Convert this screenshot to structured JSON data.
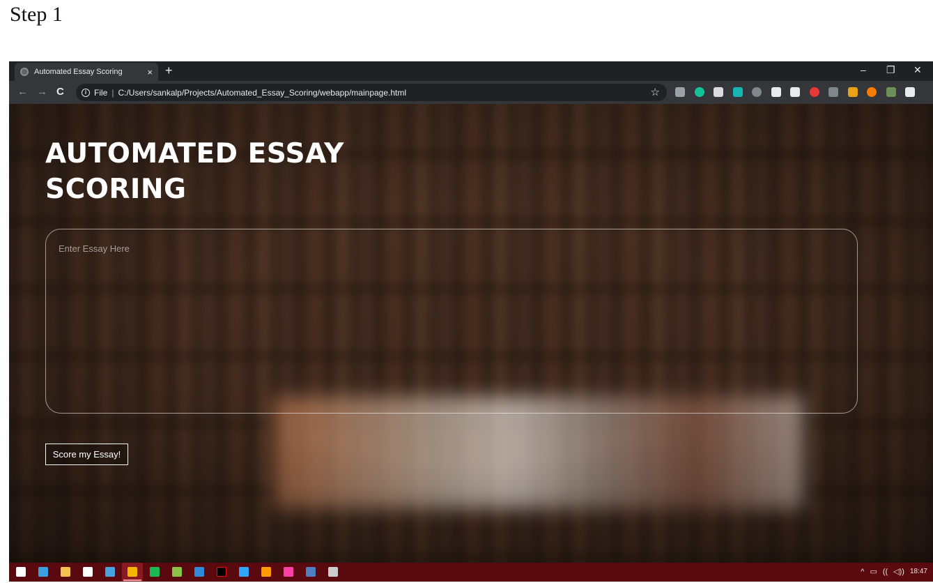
{
  "caption": "Step 1",
  "browser": {
    "tab_title": "Automated Essay Scoring",
    "tab_close": "×",
    "new_tab": "+",
    "window_controls": {
      "minimize": "–",
      "restore": "❐",
      "close": "✕"
    },
    "nav": {
      "back": "←",
      "forward": "→",
      "reload": "C"
    },
    "address": {
      "scheme_label": "File",
      "separator": "|",
      "url": "C:/Users/sankalp/Projects/Automated_Essay_Scoring/webapp/mainpage.html"
    },
    "bookmark_icon": "☆",
    "extensions": [
      {
        "name": "ext-e-icon",
        "color": "#9aa0a6"
      },
      {
        "name": "ext-grammarly-icon",
        "color": "#15c39a"
      },
      {
        "name": "ext-camera-icon",
        "color": "#dadce0"
      },
      {
        "name": "ext-teal-icon",
        "color": "#17b4b4"
      },
      {
        "name": "ext-copy-icon",
        "color": "#80868b"
      },
      {
        "name": "ext-check-icon",
        "color": "#e8eaed"
      },
      {
        "name": "ext-note-icon",
        "color": "#e8eaed"
      },
      {
        "name": "ext-red-icon",
        "color": "#e53935"
      },
      {
        "name": "ext-grey-icon",
        "color": "#80868b"
      },
      {
        "name": "ext-w-icon",
        "color": "#e8a317"
      },
      {
        "name": "ext-off-icon",
        "color": "#f57c00"
      },
      {
        "name": "profile-avatar-icon",
        "color": "#6b8e5a"
      },
      {
        "name": "menu-kebab-icon",
        "color": "#e8eaed"
      }
    ]
  },
  "page": {
    "title": "AUTOMATED ESSAY SCORING",
    "essay_placeholder": "Enter Essay Here",
    "score_button": "Score my Essay!"
  },
  "taskbar": {
    "icons": [
      {
        "name": "windows-start-icon",
        "color": "#ffffff"
      },
      {
        "name": "edge-icon",
        "color": "#3b9fe0"
      },
      {
        "name": "file-explorer-icon",
        "color": "#f2c14e"
      },
      {
        "name": "store-icon",
        "color": "#ffffff"
      },
      {
        "name": "mail-icon",
        "color": "#4aa3df"
      },
      {
        "name": "chrome-icon",
        "color": "#f4b400"
      },
      {
        "name": "spotify-icon",
        "color": "#1db954"
      },
      {
        "name": "circle-app-icon",
        "color": "#8bc34a"
      },
      {
        "name": "vscode-icon",
        "color": "#2f8ad8"
      },
      {
        "name": "netflix-icon",
        "color": "#000000"
      },
      {
        "name": "photoshop-icon",
        "color": "#31a8ff"
      },
      {
        "name": "illustrator-icon",
        "color": "#ff9a00"
      },
      {
        "name": "indesign-icon",
        "color": "#ff3fa4"
      },
      {
        "name": "app-box-icon",
        "color": "#4f7fbf"
      },
      {
        "name": "terminal-icon",
        "color": "#cccccc"
      }
    ],
    "tray": {
      "chevron": "^",
      "battery": "▭",
      "wifi": "((",
      "volume": "◁))",
      "time": "18:47"
    }
  }
}
